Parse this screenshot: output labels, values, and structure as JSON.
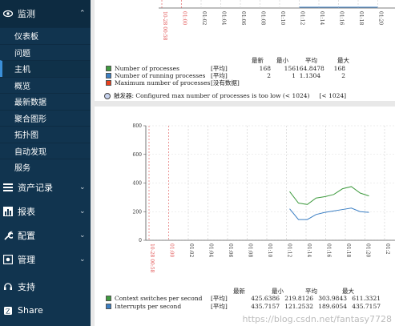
{
  "sidebar": {
    "monitor": {
      "label": "监测",
      "icon": "eye-icon"
    },
    "sub_items": [
      "仪表板",
      "问题",
      "主机",
      "概览",
      "最新数据",
      "聚合图形",
      "拓扑图",
      "自动发现",
      "服务"
    ],
    "selected_index": 2,
    "groups": [
      {
        "label": "资产记录",
        "icon": "list-icon"
      },
      {
        "label": "报表",
        "icon": "bar-chart-icon"
      },
      {
        "label": "配置",
        "icon": "wrench-icon"
      },
      {
        "label": "管理",
        "icon": "gear-icon"
      }
    ],
    "support": {
      "label": "支持",
      "icon": "headset-icon"
    },
    "share": {
      "label": "Share",
      "icon": "share-icon"
    }
  },
  "colors": {
    "sidebar_bg": "#11344f",
    "series_green": "#3f9b3f",
    "series_blue": "#3b7fc4",
    "series_red": "#e8401c",
    "time_red": "#e05050"
  },
  "graph1": {
    "header": [
      "最新",
      "最小",
      "平均",
      "最大"
    ],
    "legend": [
      {
        "name": "Number of processes",
        "fn": "[平均]",
        "values": [
          "168",
          "156",
          "164.8478",
          "168"
        ],
        "color": "#3f9b3f"
      },
      {
        "name": "Number of running processes",
        "fn": "[平均]",
        "values": [
          "2",
          "1",
          "1.1304",
          "2"
        ],
        "color": "#3b7fc4"
      },
      {
        "name": "Maximum number of processes",
        "fn": "[没有数据]",
        "values": [
          "",
          "",
          "",
          ""
        ],
        "color": "#e8401c"
      }
    ],
    "note": "触发器: Configured max number of processes is too low (< 1024)",
    "note_value": "[< 1024]"
  },
  "graph2": {
    "header": [
      "最新",
      "最小",
      "平均",
      "最大"
    ],
    "legend": [
      {
        "name": "Context switches per second",
        "fn": "[平均]",
        "values": [
          "425.6386",
          "219.8126",
          "303.9843",
          "611.3321"
        ],
        "color": "#3f9b3f"
      },
      {
        "name": "Interrupts per second",
        "fn": "[平均]",
        "values": [
          "435.7157",
          "121.2532",
          "189.6054",
          "435.7157"
        ],
        "color": "#3b7fc4"
      }
    ]
  },
  "chart_data": [
    {
      "type": "line",
      "x_tick_labels": [
        "10-28 00:58",
        "01:00",
        "01:02",
        "01:04",
        "01:06",
        "01:08",
        "01:10",
        "01:12",
        "01:14",
        "01:16",
        "01:18",
        "01:20",
        "01:2"
      ],
      "series": [
        {
          "name": "Number of running processes",
          "x": [
            "01:12",
            "01:20"
          ],
          "values": [
            2,
            2
          ]
        }
      ]
    },
    {
      "type": "line",
      "ylim": [
        0,
        800
      ],
      "y_tick_labels": [
        "800",
        "600",
        "400",
        "200",
        "0"
      ],
      "x_tick_labels": [
        "10-28 00:58",
        "01:00",
        "01:02",
        "01:04",
        "01:06",
        "01:08",
        "01:10",
        "01:12",
        "01:14",
        "01:16",
        "01:18",
        "01:20",
        "01:2"
      ],
      "series": [
        {
          "name": "Context switches per second",
          "x": [
            0,
            1,
            2,
            3,
            4,
            5,
            6,
            7,
            8,
            9
          ],
          "values": [
            340,
            260,
            250,
            295,
            305,
            320,
            360,
            375,
            330,
            310
          ]
        },
        {
          "name": "Interrupts per second",
          "x": [
            0,
            1,
            2,
            3,
            4,
            5,
            6,
            7,
            8,
            9
          ],
          "values": [
            220,
            145,
            145,
            180,
            195,
            205,
            215,
            225,
            200,
            195
          ]
        }
      ]
    }
  ],
  "watermark": "https://blog.csdn.net/fantasy7728"
}
